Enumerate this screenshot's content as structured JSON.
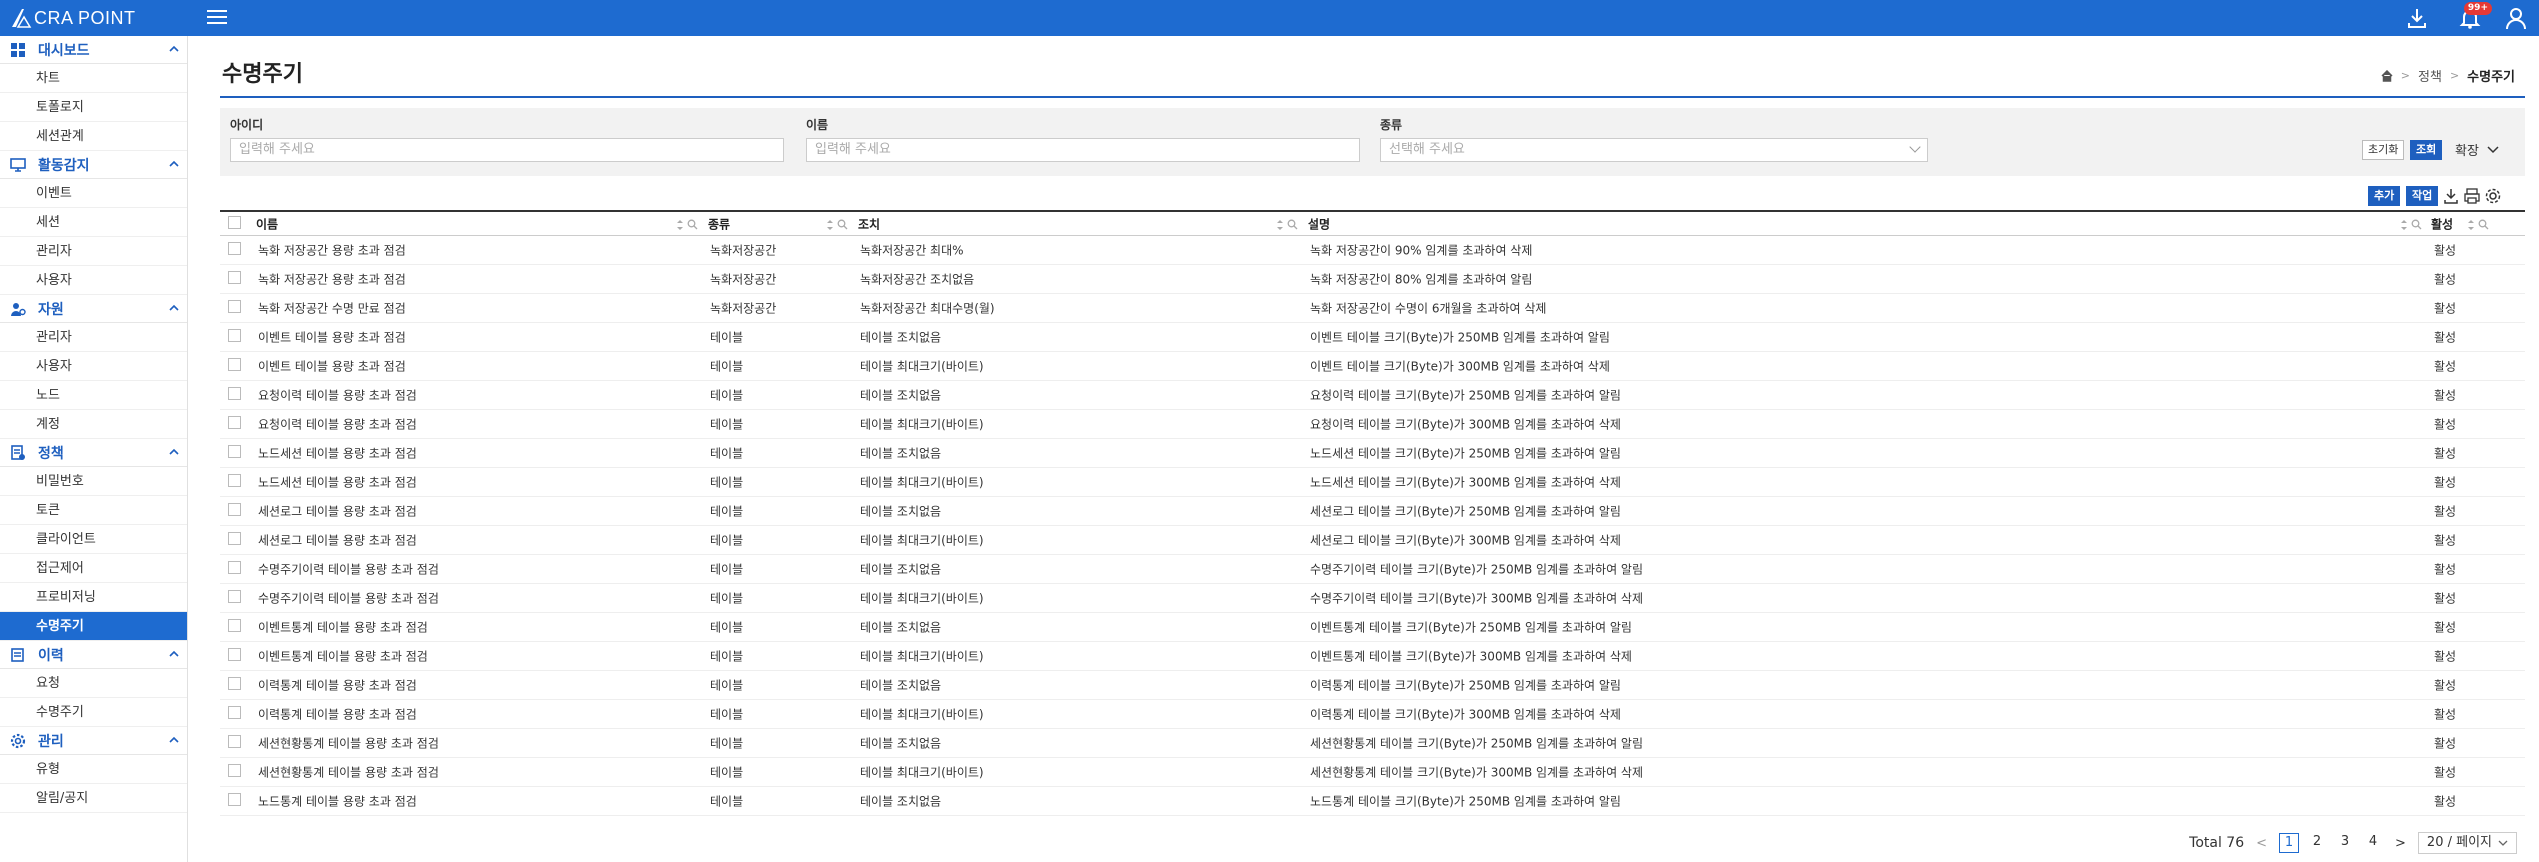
{
  "app": {
    "logo_text": "CRA POINT",
    "notification_badge": "99+",
    "accent_color": "#1e6bd0"
  },
  "sidebar": {
    "groups": [
      {
        "title": "대시보드",
        "icon": "dashboard-icon",
        "items": [
          "차트",
          "토폴로지",
          "세션관계"
        ]
      },
      {
        "title": "활동감지",
        "icon": "monitor-icon",
        "items": [
          "이벤트",
          "세션",
          "관리자",
          "사용자"
        ]
      },
      {
        "title": "자원",
        "icon": "resource-icon",
        "items": [
          "관리자",
          "사용자",
          "노드",
          "계정"
        ]
      },
      {
        "title": "정책",
        "icon": "policy-icon",
        "items": [
          "비밀번호",
          "토큰",
          "클라이언트",
          "접근제어",
          "프로비저닝",
          "수명주기"
        ]
      },
      {
        "title": "이력",
        "icon": "history-icon",
        "items": [
          "요청",
          "수명주기"
        ]
      },
      {
        "title": "관리",
        "icon": "gear-icon",
        "items": [
          "유형",
          "알림/공지"
        ]
      }
    ],
    "active_item": "수명주기"
  },
  "page": {
    "title": "수명주기",
    "breadcrumb": [
      "정책",
      "수명주기"
    ]
  },
  "search": {
    "id_label": "아이디",
    "id_placeholder": "입력해 주세요",
    "name_label": "이름",
    "name_placeholder": "입력해 주세요",
    "type_label": "종류",
    "type_placeholder": "선택해 주세요",
    "reset_label": "초기화",
    "search_label": "조회",
    "expand_label": "확장"
  },
  "toolbar": {
    "add_label": "추가",
    "action_label": "작업"
  },
  "table": {
    "columns": {
      "name": "이름",
      "type": "종류",
      "action": "조치",
      "desc": "설명",
      "status": "활성"
    },
    "rows": [
      {
        "name": "녹화 저장공간 용량 초과 점검",
        "type": "녹화저장공간",
        "action": "녹화저장공간 최대%",
        "desc": "녹화 저장공간이 90% 임계를 초과하여 삭제",
        "status": "활성"
      },
      {
        "name": "녹화 저장공간 용량 초과 점검",
        "type": "녹화저장공간",
        "action": "녹화저장공간 조치없음",
        "desc": "녹화 저장공간이 80% 임계를 초과하여 알림",
        "status": "활성"
      },
      {
        "name": "녹화 저장공간 수명 만료 점검",
        "type": "녹화저장공간",
        "action": "녹화저장공간 최대수명(월)",
        "desc": "녹화 저장공간이 수명이 6개월을 초과하여 삭제",
        "status": "활성"
      },
      {
        "name": "이벤트 테이블 용량 초과 점검",
        "type": "테이블",
        "action": "테이블 조치없음",
        "desc": "이벤트 테이블 크기(Byte)가 250MB 임계를 초과하여 알림",
        "status": "활성"
      },
      {
        "name": "이벤트 테이블 용량 초과 점검",
        "type": "테이블",
        "action": "테이블 최대크기(바이트)",
        "desc": "이벤트 테이블 크기(Byte)가 300MB 임계를 초과하여 삭제",
        "status": "활성"
      },
      {
        "name": "요청이력 테이블 용량 초과 점검",
        "type": "테이블",
        "action": "테이블 조치없음",
        "desc": "요청이력 테이블 크기(Byte)가 250MB 임계를 초과하여 알림",
        "status": "활성"
      },
      {
        "name": "요청이력 테이블 용량 초과 점검",
        "type": "테이블",
        "action": "테이블 최대크기(바이트)",
        "desc": "요청이력 테이블 크기(Byte)가 300MB 임계를 초과하여 삭제",
        "status": "활성"
      },
      {
        "name": "노드세션 테이블 용량 초과 점검",
        "type": "테이블",
        "action": "테이블 조치없음",
        "desc": "노드세션 테이블 크기(Byte)가 250MB 임계를 초과하여 알림",
        "status": "활성"
      },
      {
        "name": "노드세션 테이블 용량 초과 점검",
        "type": "테이블",
        "action": "테이블 최대크기(바이트)",
        "desc": "노드세션 테이블 크기(Byte)가 300MB 임계를 초과하여 삭제",
        "status": "활성"
      },
      {
        "name": "세션로그 테이블 용량 초과 점검",
        "type": "테이블",
        "action": "테이블 조치없음",
        "desc": "세션로그 테이블 크기(Byte)가 250MB 임계를 초과하여 알림",
        "status": "활성"
      },
      {
        "name": "세션로그 테이블 용량 초과 점검",
        "type": "테이블",
        "action": "테이블 최대크기(바이트)",
        "desc": "세션로그 테이블 크기(Byte)가 300MB 임계를 초과하여 삭제",
        "status": "활성"
      },
      {
        "name": "수명주기이력 테이블 용량 초과 점검",
        "type": "테이블",
        "action": "테이블 조치없음",
        "desc": "수명주기이력 테이블 크기(Byte)가 250MB 임계를 초과하여 알림",
        "status": "활성"
      },
      {
        "name": "수명주기이력 테이블 용량 초과 점검",
        "type": "테이블",
        "action": "테이블 최대크기(바이트)",
        "desc": "수명주기이력 테이블 크기(Byte)가 300MB 임계를 초과하여 삭제",
        "status": "활성"
      },
      {
        "name": "이벤트통계 테이블 용량 초과 점검",
        "type": "테이블",
        "action": "테이블 조치없음",
        "desc": "이벤트통계 테이블 크기(Byte)가 250MB 임계를 초과하여 알림",
        "status": "활성"
      },
      {
        "name": "이벤트통계 테이블 용량 초과 점검",
        "type": "테이블",
        "action": "테이블 최대크기(바이트)",
        "desc": "이벤트통계 테이블 크기(Byte)가 300MB 임계를 초과하여 삭제",
        "status": "활성"
      },
      {
        "name": "이력통계 테이블 용량 초과 점검",
        "type": "테이블",
        "action": "테이블 조치없음",
        "desc": "이력통계 테이블 크기(Byte)가 250MB 임계를 초과하여 알림",
        "status": "활성"
      },
      {
        "name": "이력통계 테이블 용량 초과 점검",
        "type": "테이블",
        "action": "테이블 최대크기(바이트)",
        "desc": "이력통계 테이블 크기(Byte)가 300MB 임계를 초과하여 삭제",
        "status": "활성"
      },
      {
        "name": "세션현황통계 테이블 용량 초과 점검",
        "type": "테이블",
        "action": "테이블 조치없음",
        "desc": "세션현황통계 테이블 크기(Byte)가 250MB 임계를 초과하여 알림",
        "status": "활성"
      },
      {
        "name": "세션현황통계 테이블 용량 초과 점검",
        "type": "테이블",
        "action": "테이블 최대크기(바이트)",
        "desc": "세션현황통계 테이블 크기(Byte)가 300MB 임계를 초과하여 삭제",
        "status": "활성"
      },
      {
        "name": "노드통계 테이블 용량 초과 점검",
        "type": "테이블",
        "action": "테이블 조치없음",
        "desc": "노드통계 테이블 크기(Byte)가 250MB 임계를 초과하여 알림",
        "status": "활성"
      }
    ]
  },
  "pagination": {
    "total": "Total 76",
    "pages": [
      "1",
      "2",
      "3",
      "4"
    ],
    "current": "1",
    "page_size": "20 / 페이지"
  }
}
